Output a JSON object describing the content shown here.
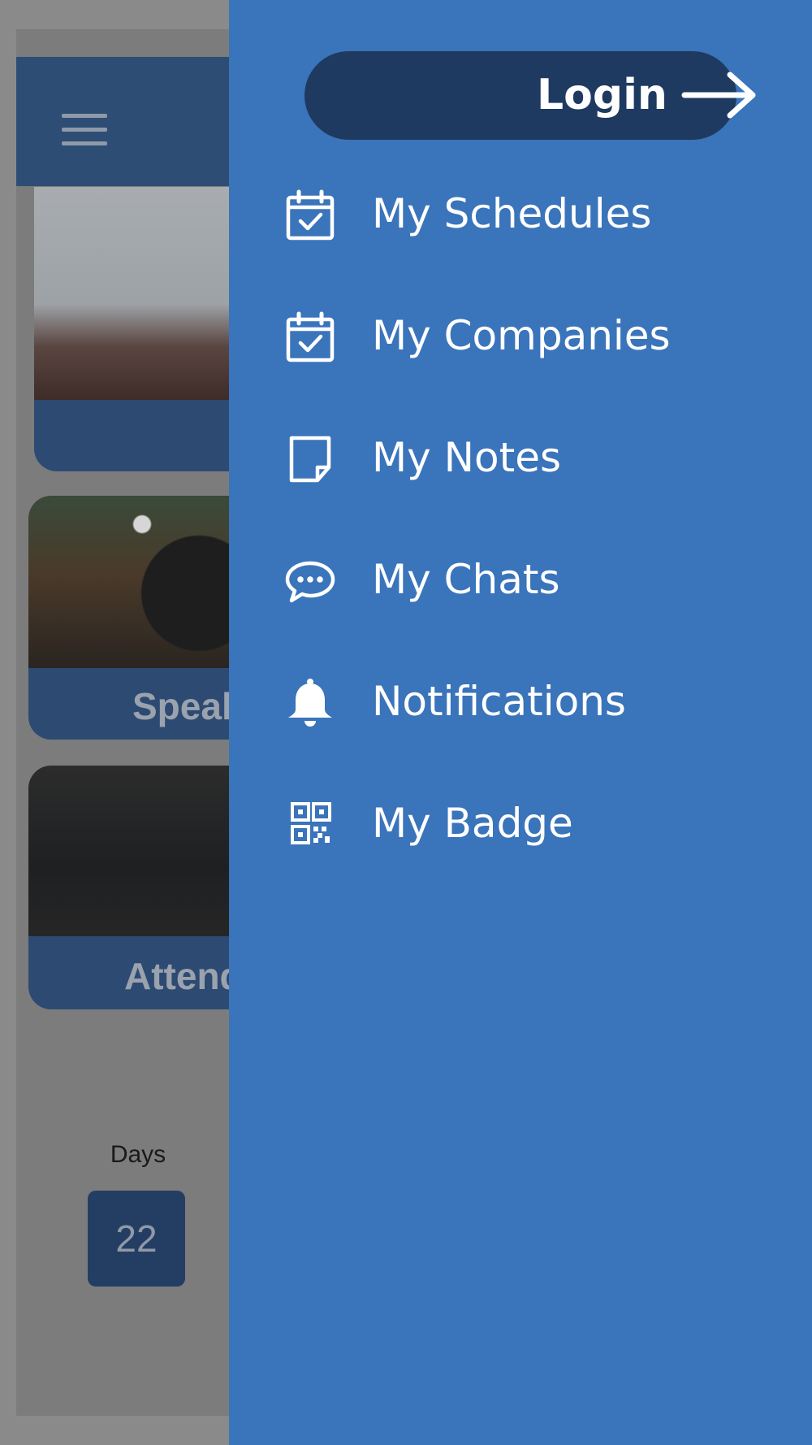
{
  "background": {
    "cards": [
      {
        "caption": ""
      },
      {
        "caption": "Speak"
      },
      {
        "caption": "Attend"
      }
    ],
    "countdown": {
      "label": "Days",
      "value": "22"
    }
  },
  "drawer": {
    "login": {
      "label": "Login",
      "icon": "arrow-right-icon"
    },
    "items": [
      {
        "label": "My Schedules",
        "icon": "calendar-check-icon"
      },
      {
        "label": "My Companies",
        "icon": "calendar-check-icon"
      },
      {
        "label": "My Notes",
        "icon": "note-icon"
      },
      {
        "label": "My Chats",
        "icon": "chat-bubble-icon"
      },
      {
        "label": "Notifications",
        "icon": "bell-icon"
      },
      {
        "label": "My Badge",
        "icon": "qr-code-icon"
      }
    ]
  },
  "colors": {
    "drawer_bg": "#3a74bb",
    "login_button_bg": "#1f3a60",
    "text": "#ffffff",
    "scrim_header": "#2e4d75"
  }
}
